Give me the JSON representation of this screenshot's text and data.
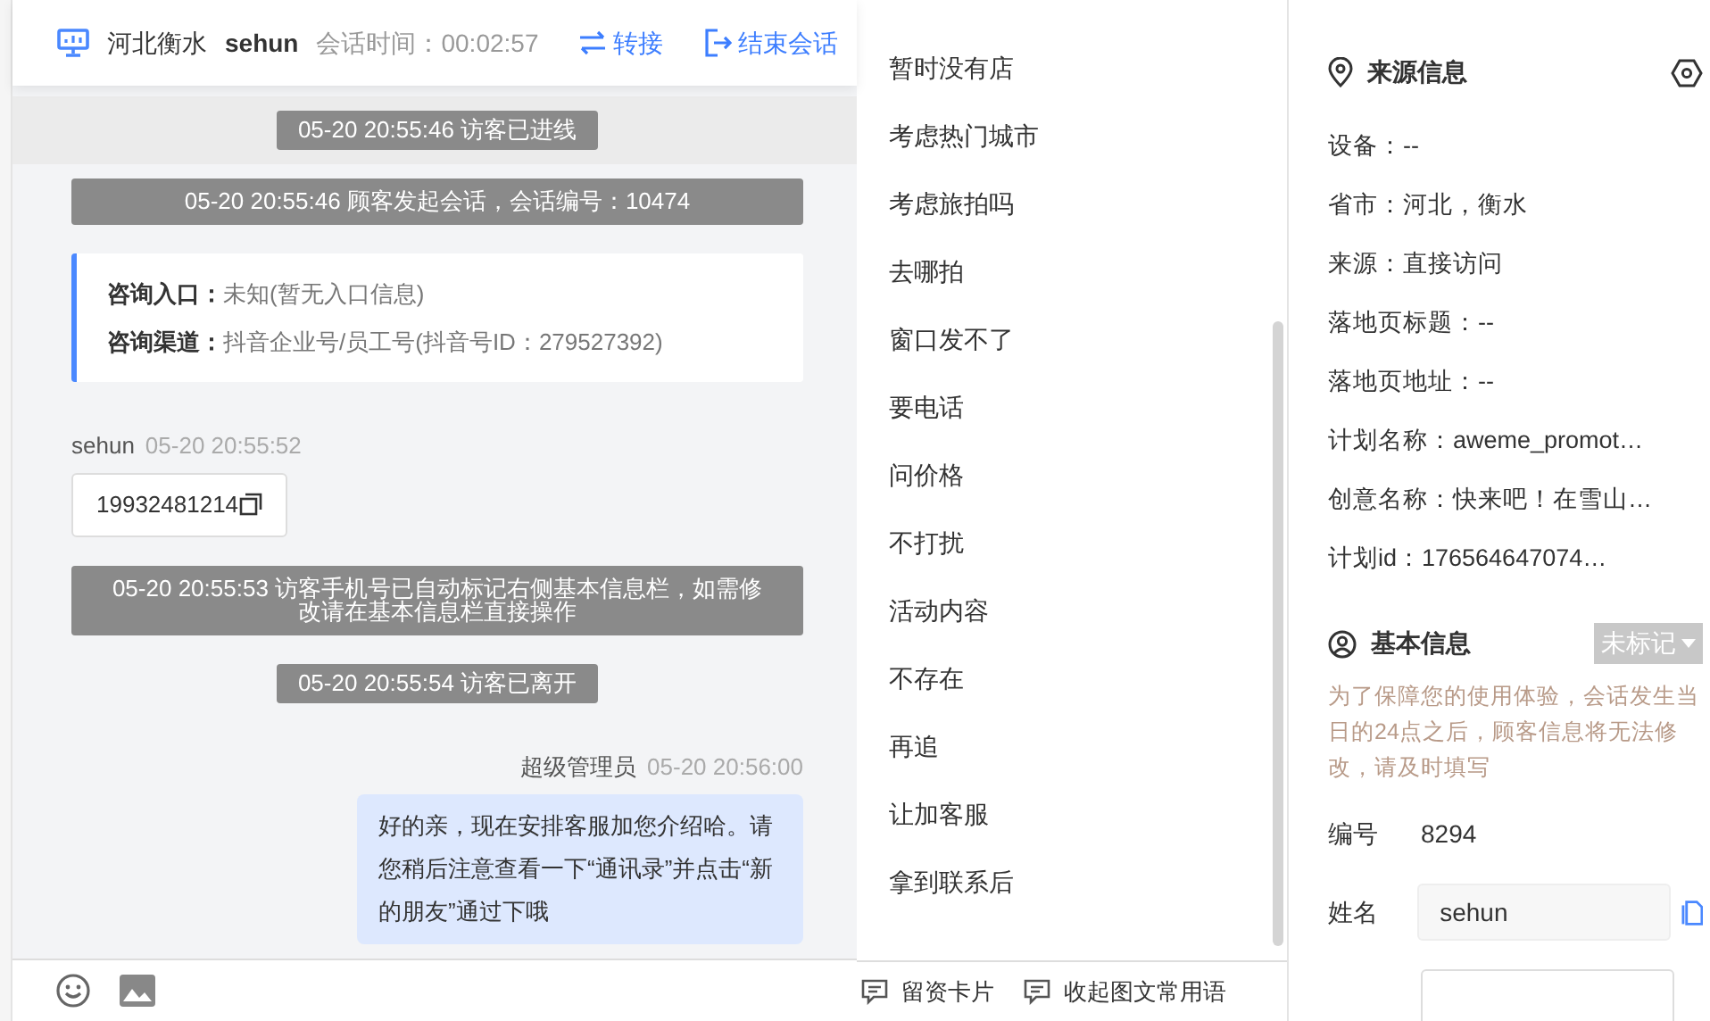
{
  "header": {
    "location": "河北衡水",
    "visitor": "sehun",
    "timer_label": "会话时间：",
    "timer": "00:02:57",
    "transfer_button": "转接",
    "end_button": "结束会话"
  },
  "messages": [
    {
      "kind": "cut_bubble"
    },
    {
      "kind": "system",
      "text": "05-20 20:55:46 访客已进线",
      "highlighted": true
    },
    {
      "kind": "system",
      "text": "05-20 20:55:46 顾客发起会话，会话编号：10474",
      "highlighted": false
    },
    {
      "kind": "info",
      "rows": [
        {
          "label": "咨询入口：",
          "value": "未知(暂无入口信息)"
        },
        {
          "label": "咨询渠道：",
          "value": "抖音企业号/员工号(抖音号ID：279527392)"
        }
      ]
    },
    {
      "kind": "visitor",
      "sender": "sehun",
      "time": "05-20 20:55:52",
      "text": "19932481214"
    },
    {
      "kind": "system",
      "text": "05-20 20:55:53 访客手机号已自动标记右侧基本信息栏，如需修改请在基本信息栏直接操作",
      "highlighted": false
    },
    {
      "kind": "system",
      "text": "05-20 20:55:54 访客已离开",
      "highlighted": false
    },
    {
      "kind": "agent",
      "sender": "超级管理员",
      "time": "05-20 20:56:00",
      "text": "好的亲，现在安排客服加您介绍哈。请您稍后注意查看一下“通讯录”并点击“新的朋友”通过下哦"
    }
  ],
  "phrases": [
    "暂时没有店",
    "考虑热门城市",
    "考虑旅拍吗",
    "去哪拍",
    "窗口发不了",
    "要电话",
    "问价格",
    "不打扰",
    "活动内容",
    "不存在",
    "再追",
    "让加客服",
    "拿到联系后"
  ],
  "phrase_footer": [
    "留资卡片",
    "收起图文常用语"
  ],
  "source_info": {
    "title": "来源信息",
    "rows": [
      "设备：--",
      "省市：河北，衡水",
      "来源：直接访问",
      "落地页标题：--",
      "落地页地址：--",
      "计划名称：aweme_promot…",
      "创意名称：快来吧！在雪山…",
      "计划id：176564647074…"
    ]
  },
  "basic_info": {
    "title": "基本信息",
    "tag": "未标记",
    "notice": "为了保障您的使用体验，会话发生当日的24点之后，顾客信息将无法修改，请及时填写",
    "fields": [
      {
        "kind": "text",
        "label": "编号",
        "value": "8294"
      },
      {
        "kind": "input",
        "label": "姓名",
        "value": "sehun"
      },
      {
        "kind": "cut_input"
      }
    ]
  }
}
